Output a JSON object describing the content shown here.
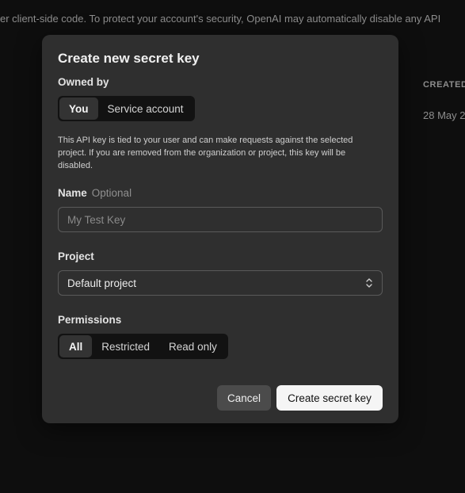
{
  "background": {
    "notice_text": "er client-side code. To protect your account's security, OpenAI may automatically disable any API",
    "created_header": "CREATED",
    "created_date": "28 May 2"
  },
  "modal": {
    "title": "Create new secret key",
    "owned_by": {
      "label": "Owned by",
      "options": [
        "You",
        "Service account"
      ],
      "selected": "You"
    },
    "description": "This API key is tied to your user and can make requests against the selected project. If you are removed from the organization or project, this key will be disabled.",
    "name": {
      "label": "Name",
      "optional_label": "Optional",
      "value": "",
      "placeholder": "My Test Key"
    },
    "project": {
      "label": "Project",
      "selected": "Default project",
      "icon": "chevron-up-down-icon"
    },
    "permissions": {
      "label": "Permissions",
      "options": [
        "All",
        "Restricted",
        "Read only"
      ],
      "selected": "All"
    },
    "buttons": {
      "cancel": "Cancel",
      "create": "Create secret key"
    }
  },
  "colors": {
    "modal_bg": "#2f2f2f",
    "page_bg": "#0e0e0e",
    "primary_button": "#f5f5f5",
    "secondary_button": "#4b4b4b"
  }
}
